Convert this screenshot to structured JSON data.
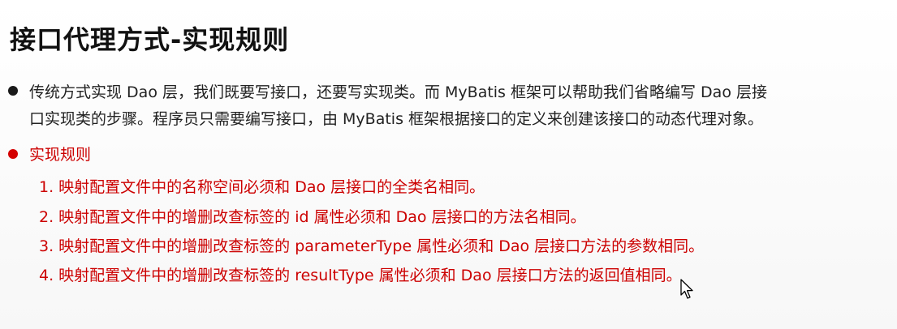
{
  "title": "接口代理方式-实现规则",
  "intro": {
    "line1": "传统方式实现 Dao 层，我们既要写接口，还要写实现类。而 MyBatis 框架可以帮助我们省略编写 Dao 层接",
    "line2": "口实现类的步骤。程序员只需要编写接口，由 MyBatis 框架根据接口的定义来创建该接口的动态代理对象。"
  },
  "rules": {
    "heading": "实现规则",
    "items": [
      "1. 映射配置文件中的名称空间必须和 Dao 层接口的全类名相同。",
      "2. 映射配置文件中的增删改查标签的 id 属性必须和 Dao 层接口的方法名相同。",
      "3. 映射配置文件中的增删改查标签的 parameterType 属性必须和 Dao 层接口方法的参数相同。",
      "4. 映射配置文件中的增删改查标签的 resultType 属性必须和 Dao 层接口方法的返回值相同。"
    ]
  },
  "colors": {
    "title": "#111111",
    "body_text": "#222222",
    "accent_red": "#cc0000"
  },
  "icons": {
    "cursor": "mouse-pointer-icon"
  }
}
